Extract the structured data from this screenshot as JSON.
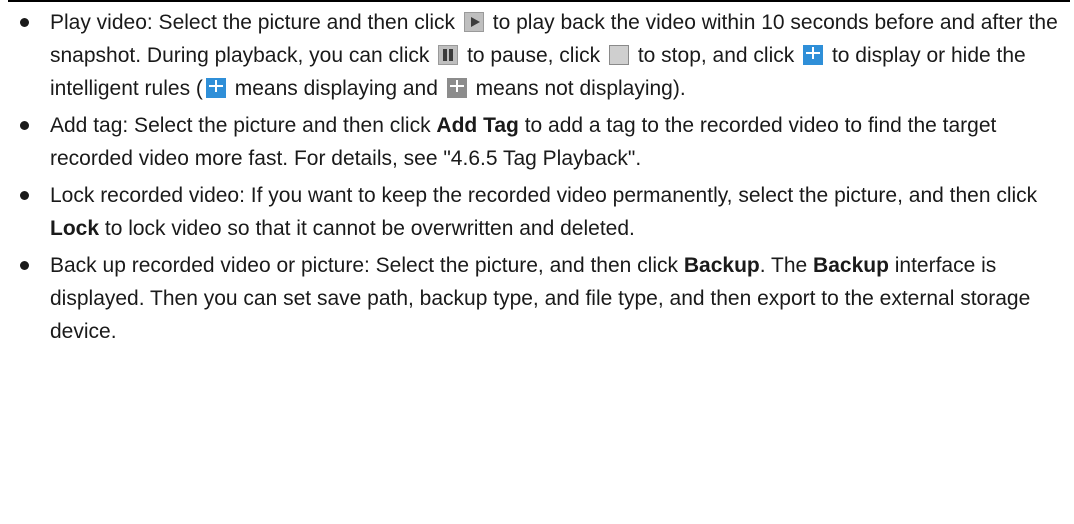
{
  "items": [
    {
      "t1": "Play video: Select the picture and then click",
      "t2": "to play back the video within 10 seconds before and after the snapshot. During playback, you can click",
      "t3": "to pause, click",
      "t4": "to stop, and click",
      "t5": "to display or hide the intelligent rules (",
      "t6": "means displaying and",
      "t7": "means not displaying)."
    },
    {
      "t1": "Add tag: Select the picture and then click",
      "b1": "Add Tag",
      "t2": "to add a tag to the recorded video to find the target recorded video more fast. For details, see \"4.6.5 Tag Playback\"."
    },
    {
      "t1": "Lock recorded video: If you want to keep the recorded video permanently, select the picture, and then click",
      "b1": "Lock",
      "t2": "to lock video so that it cannot be overwritten and deleted."
    },
    {
      "t1": "Back up recorded video or picture: Select the picture, and then click",
      "b1": "Backup",
      "t2": ". The",
      "b2": "Backup",
      "t3": "interface is displayed. Then you can set save path, backup type, and file type, and then export to the external storage device."
    }
  ],
  "icons": {
    "play": "play-icon",
    "pause": "pause-icon",
    "stop": "stop-icon",
    "rules_on": "intelligent-rules-on-icon",
    "rules_off": "intelligent-rules-off-icon"
  },
  "colors": {
    "rules_on": "#2f8fd8",
    "rules_off": "#8c8c8c"
  }
}
